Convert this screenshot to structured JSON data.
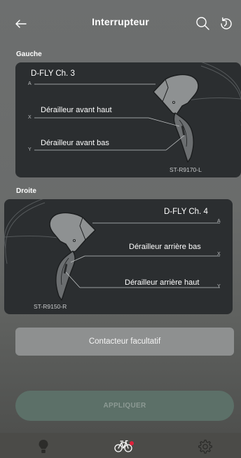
{
  "header": {
    "title": "Interrupteur",
    "back_icon": "back-arrow-icon",
    "search_icon": "search-icon",
    "history_icon": "history-icon"
  },
  "left_section": {
    "label": "Gauche",
    "switches": [
      {
        "axis": "A",
        "label": "D-FLY Ch. 3"
      },
      {
        "axis": "X",
        "label": "Dérailleur avant haut"
      },
      {
        "axis": "Y",
        "label": "Dérailleur avant bas"
      }
    ],
    "model": "ST-R9170-L"
  },
  "right_section": {
    "label": "Droite",
    "switches": [
      {
        "axis": "A",
        "label": "D-FLY Ch. 4"
      },
      {
        "axis": "X",
        "label": "Dérailleur arrière bas"
      },
      {
        "axis": "Y",
        "label": "Dérailleur arrière haut"
      }
    ],
    "model": "ST-R9150-R"
  },
  "optional_button": {
    "label": "Contacteur facultatif"
  },
  "apply_button": {
    "label": "APPLIQUER"
  },
  "bottom_nav": {
    "items": [
      {
        "icon": "bulb-icon"
      },
      {
        "icon": "bike-icon"
      },
      {
        "icon": "gear-icon"
      }
    ]
  },
  "colors": {
    "card_bg": "#2b2e30",
    "apply_bg": "#5c7068",
    "notification_dot": "#e0203a"
  }
}
